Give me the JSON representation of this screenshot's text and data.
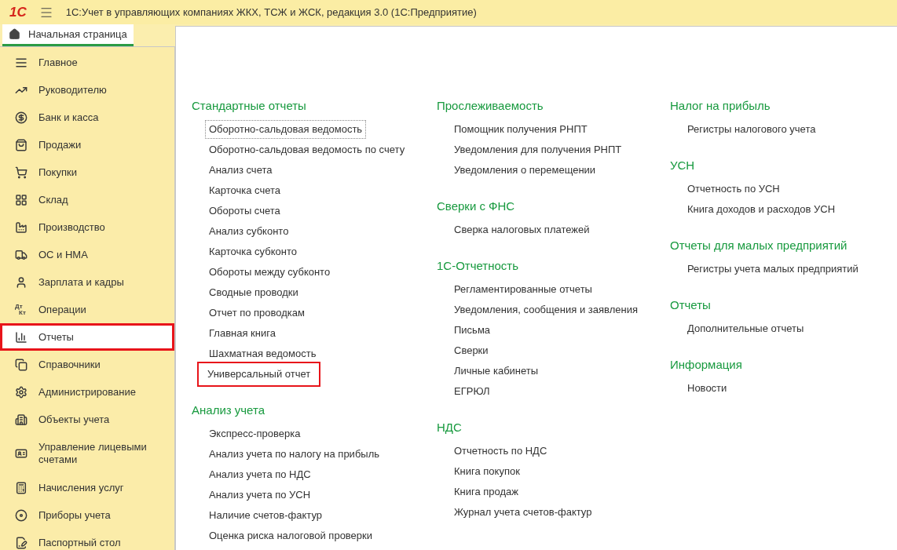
{
  "window": {
    "logo": "1С",
    "title": "1С:Учет в управляющих компаниях ЖКХ, ТСЖ и ЖСК, редакция 3.0  (1С:Предприятие)"
  },
  "tabs": [
    {
      "label": "Начальная страница",
      "selected": true
    }
  ],
  "sidebar": {
    "items": [
      {
        "label": "Главное",
        "selected": false,
        "highlighted": false
      },
      {
        "label": "Руководителю",
        "selected": false,
        "highlighted": false
      },
      {
        "label": "Банк и касса",
        "selected": false,
        "highlighted": false
      },
      {
        "label": "Продажи",
        "selected": false,
        "highlighted": false
      },
      {
        "label": "Покупки",
        "selected": false,
        "highlighted": false
      },
      {
        "label": "Склад",
        "selected": false,
        "highlighted": false
      },
      {
        "label": "Производство",
        "selected": false,
        "highlighted": false
      },
      {
        "label": "ОС и НМА",
        "selected": false,
        "highlighted": false
      },
      {
        "label": "Зарплата и кадры",
        "selected": false,
        "highlighted": false
      },
      {
        "label": "Операции",
        "selected": false,
        "highlighted": false,
        "icon_text": [
          "Дт",
          "Кт"
        ]
      },
      {
        "label": "Отчеты",
        "selected": true,
        "highlighted": true
      },
      {
        "label": "Справочники",
        "selected": false,
        "highlighted": false
      },
      {
        "label": "Администрирование",
        "selected": false,
        "highlighted": false
      },
      {
        "label": "Объекты учета",
        "selected": false,
        "highlighted": false
      },
      {
        "label": "Управление лицевыми счетами",
        "selected": false,
        "highlighted": false
      },
      {
        "label": "Начисления услуг",
        "selected": false,
        "highlighted": false
      },
      {
        "label": "Приборы учета",
        "selected": false,
        "highlighted": false
      },
      {
        "label": "Паспортный стол",
        "selected": false,
        "highlighted": false
      }
    ]
  },
  "columns": [
    [
      {
        "title": "Стандартные отчеты",
        "links": [
          {
            "label": "Оборотно-сальдовая ведомость",
            "focused": true,
            "highlighted": false
          },
          {
            "label": "Оборотно-сальдовая ведомость по счету",
            "focused": false,
            "highlighted": false
          },
          {
            "label": "Анализ счета",
            "focused": false,
            "highlighted": false
          },
          {
            "label": "Карточка счета",
            "focused": false,
            "highlighted": false
          },
          {
            "label": "Обороты счета",
            "focused": false,
            "highlighted": false
          },
          {
            "label": "Анализ субконто",
            "focused": false,
            "highlighted": false
          },
          {
            "label": "Карточка субконто",
            "focused": false,
            "highlighted": false
          },
          {
            "label": "Обороты между субконто",
            "focused": false,
            "highlighted": false
          },
          {
            "label": "Сводные проводки",
            "focused": false,
            "highlighted": false
          },
          {
            "label": "Отчет по проводкам",
            "focused": false,
            "highlighted": false
          },
          {
            "label": "Главная книга",
            "focused": false,
            "highlighted": false
          },
          {
            "label": "Шахматная ведомость",
            "focused": false,
            "highlighted": false
          },
          {
            "label": "Универсальный отчет",
            "focused": false,
            "highlighted": true
          }
        ]
      },
      {
        "title": "Анализ учета",
        "links": [
          {
            "label": "Экспресс-проверка",
            "focused": false,
            "highlighted": false
          },
          {
            "label": "Анализ учета по налогу на прибыль",
            "focused": false,
            "highlighted": false
          },
          {
            "label": "Анализ учета по НДС",
            "focused": false,
            "highlighted": false
          },
          {
            "label": "Анализ учета по УСН",
            "focused": false,
            "highlighted": false
          },
          {
            "label": "Наличие счетов-фактур",
            "focused": false,
            "highlighted": false
          },
          {
            "label": "Оценка риска налоговой проверки",
            "focused": false,
            "highlighted": false
          }
        ]
      }
    ],
    [
      {
        "title": "Прослеживаемость",
        "links": [
          {
            "label": "Помощник получения РНПТ",
            "focused": false,
            "highlighted": false
          },
          {
            "label": "Уведомления для получения РНПТ",
            "focused": false,
            "highlighted": false
          },
          {
            "label": "Уведомления о перемещении",
            "focused": false,
            "highlighted": false
          }
        ]
      },
      {
        "title": "Сверки с ФНС",
        "links": [
          {
            "label": "Сверка налоговых платежей",
            "focused": false,
            "highlighted": false
          }
        ]
      },
      {
        "title": "1С-Отчетность",
        "links": [
          {
            "label": "Регламентированные отчеты",
            "focused": false,
            "highlighted": false
          },
          {
            "label": "Уведомления, сообщения и заявления",
            "focused": false,
            "highlighted": false
          },
          {
            "label": "Письма",
            "focused": false,
            "highlighted": false
          },
          {
            "label": "Сверки",
            "focused": false,
            "highlighted": false
          },
          {
            "label": "Личные кабинеты",
            "focused": false,
            "highlighted": false
          },
          {
            "label": "ЕГРЮЛ",
            "focused": false,
            "highlighted": false
          }
        ]
      },
      {
        "title": "НДС",
        "links": [
          {
            "label": "Отчетность по НДС",
            "focused": false,
            "highlighted": false
          },
          {
            "label": "Книга покупок",
            "focused": false,
            "highlighted": false
          },
          {
            "label": "Книга продаж",
            "focused": false,
            "highlighted": false
          },
          {
            "label": "Журнал учета счетов-фактур",
            "focused": false,
            "highlighted": false
          }
        ]
      }
    ],
    [
      {
        "title": "Налог на прибыль",
        "links": [
          {
            "label": "Регистры налогового учета",
            "focused": false,
            "highlighted": false
          }
        ]
      },
      {
        "title": "УСН",
        "links": [
          {
            "label": "Отчетность по УСН",
            "focused": false,
            "highlighted": false
          },
          {
            "label": "Книга доходов и расходов УСН",
            "focused": false,
            "highlighted": false
          }
        ]
      },
      {
        "title": "Отчеты для малых предприятий",
        "links": [
          {
            "label": "Регистры учета малых предприятий",
            "focused": false,
            "highlighted": false
          }
        ]
      },
      {
        "title": "Отчеты",
        "links": [
          {
            "label": "Дополнительные отчеты",
            "focused": false,
            "highlighted": false
          }
        ]
      },
      {
        "title": "Информация",
        "links": [
          {
            "label": "Новости",
            "focused": false,
            "highlighted": false
          }
        ]
      }
    ]
  ]
}
